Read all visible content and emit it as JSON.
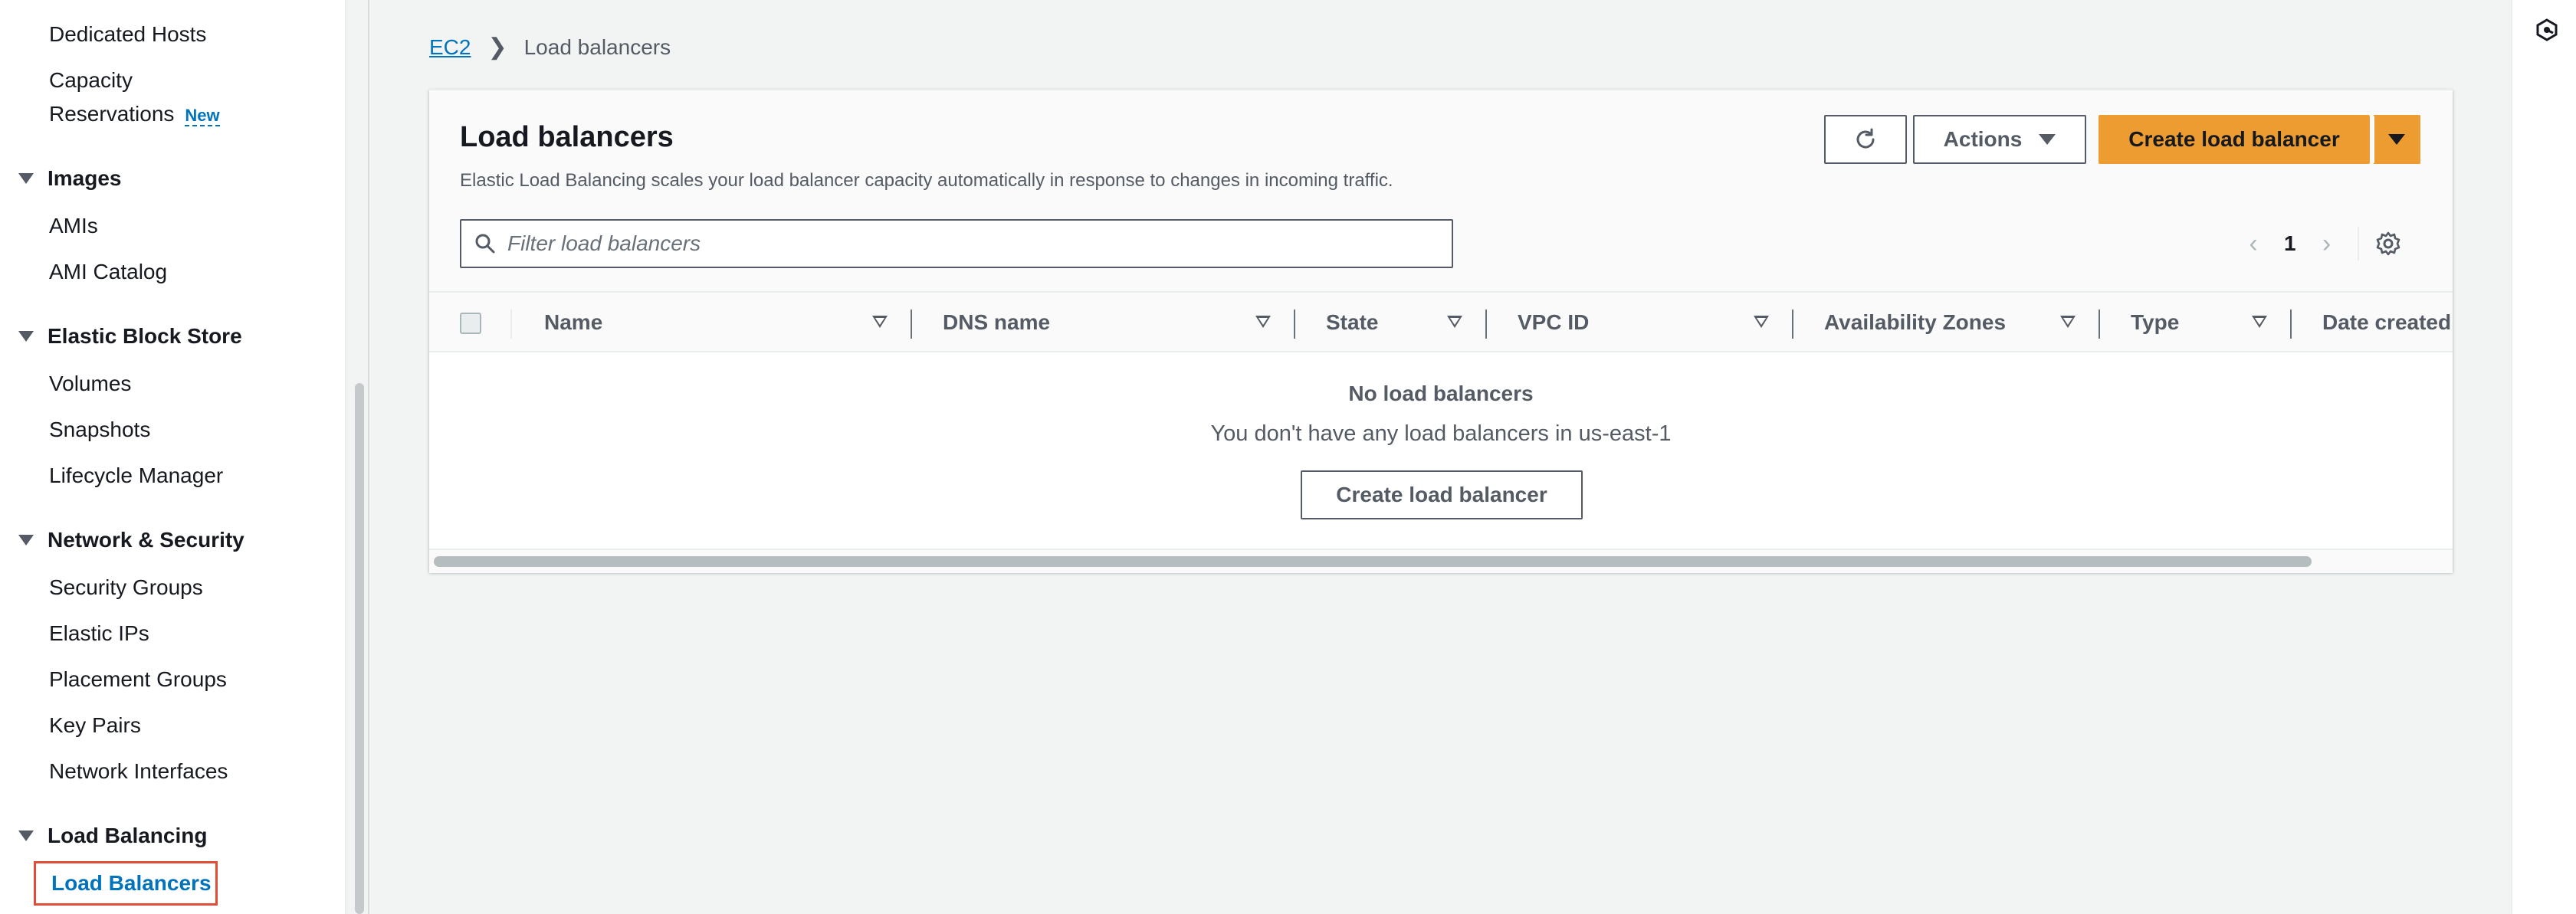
{
  "sidebar": {
    "items_top": [
      "Dedicated Hosts",
      "Capacity",
      "Reservations"
    ],
    "new_badge": "New",
    "sections": [
      {
        "title": "Images",
        "items": [
          "AMIs",
          "AMI Catalog"
        ]
      },
      {
        "title": "Elastic Block Store",
        "items": [
          "Volumes",
          "Snapshots",
          "Lifecycle Manager"
        ]
      },
      {
        "title": "Network & Security",
        "items": [
          "Security Groups",
          "Elastic IPs",
          "Placement Groups",
          "Key Pairs",
          "Network Interfaces"
        ]
      },
      {
        "title": "Load Balancing",
        "items": [
          "Load Balancers"
        ]
      }
    ]
  },
  "breadcrumb": {
    "parent": "EC2",
    "current": "Load balancers"
  },
  "panel": {
    "title": "Load balancers",
    "description": "Elastic Load Balancing scales your load balancer capacity automatically in response to changes in incoming traffic.",
    "actions_label": "Actions",
    "create_label": "Create load balancer",
    "search_placeholder": "Filter load balancers",
    "page_number": "1"
  },
  "table": {
    "columns": [
      "Name",
      "DNS name",
      "State",
      "VPC ID",
      "Availability Zones",
      "Type",
      "Date created"
    ],
    "empty_title": "No load balancers",
    "empty_description": "You don't have any load balancers in us-east-1",
    "empty_button": "Create load balancer"
  },
  "colors": {
    "accent": "#ec9c30",
    "link": "#0073bb",
    "highlight": "#e04e39"
  }
}
